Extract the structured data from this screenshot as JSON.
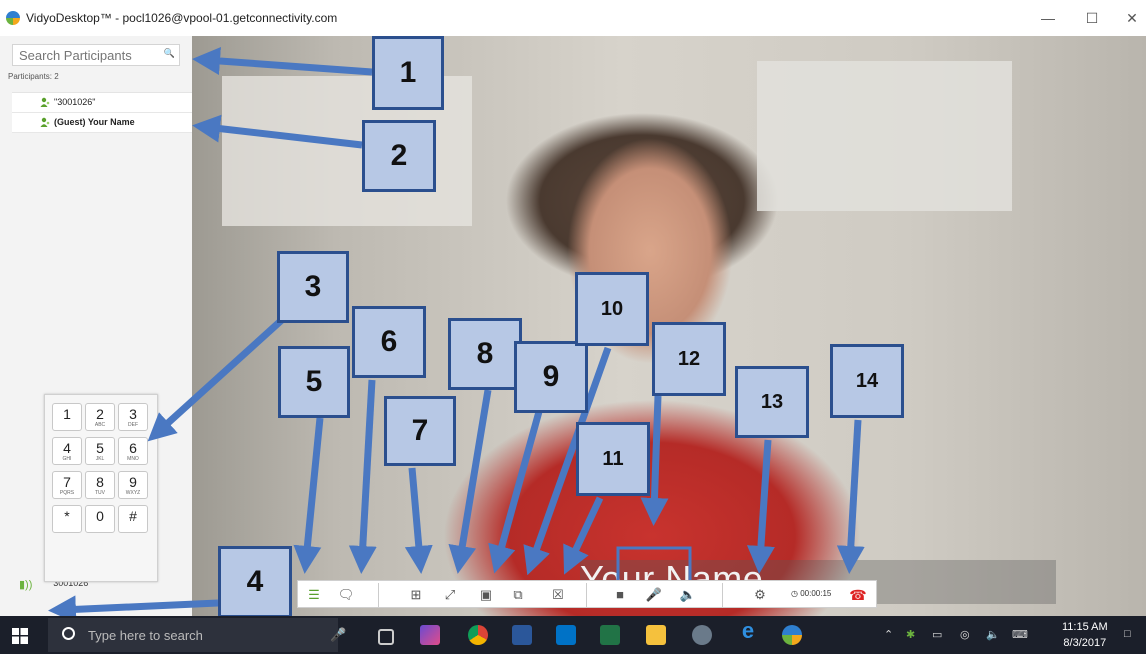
{
  "window": {
    "title": "VidyoDesktop™ - pocl1026@vpool-01.getconnectivity.com",
    "minimize": "—",
    "maximize": "☐",
    "close": "✕"
  },
  "sidebar": {
    "search_placeholder": "Search Participants",
    "participants_label": "Participants: 2",
    "participants": [
      {
        "name": "\"3001026\""
      },
      {
        "name": "(Guest) Your Name"
      }
    ],
    "speaker_label": "\"3001026\""
  },
  "keypad": {
    "keys": [
      {
        "num": "1",
        "letters": ""
      },
      {
        "num": "2",
        "letters": "ABC"
      },
      {
        "num": "3",
        "letters": "DEF"
      },
      {
        "num": "4",
        "letters": "GHI"
      },
      {
        "num": "5",
        "letters": "JKL"
      },
      {
        "num": "6",
        "letters": "MNO"
      },
      {
        "num": "7",
        "letters": "PQRS"
      },
      {
        "num": "8",
        "letters": "TUV"
      },
      {
        "num": "9",
        "letters": "WXYZ"
      },
      {
        "num": "*",
        "letters": ""
      },
      {
        "num": "0",
        "letters": ""
      },
      {
        "num": "#",
        "letters": ""
      }
    ]
  },
  "video": {
    "name_overlay": "Your Name"
  },
  "toolbar": {
    "timer": "◷ 00:00:15"
  },
  "callouts": [
    "1",
    "2",
    "3",
    "4",
    "5",
    "6",
    "7",
    "8",
    "9",
    "10",
    "11",
    "12",
    "13",
    "14"
  ],
  "taskbar": {
    "search_placeholder": "Type here to search",
    "time": "11:15 AM",
    "date": "8/3/2017"
  },
  "colors": {
    "callout_fill": "#b7c8e5",
    "callout_border": "#2b4f8e",
    "arrow": "#4a78c2",
    "hangup": "#dd2222",
    "taskbar": "#1b1f2a"
  }
}
